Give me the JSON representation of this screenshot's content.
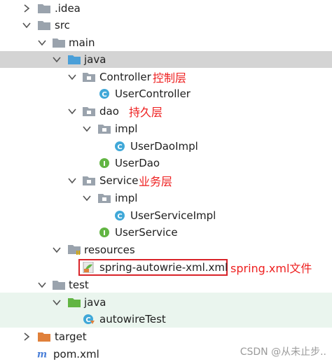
{
  "tree": {
    "idea": "idea",
    "idea_label": ".idea",
    "src": "src",
    "main": "main",
    "java": "java",
    "controller": "Controller",
    "controller_note": "控制层",
    "user_controller": "UserController",
    "dao": "dao",
    "dao_note": "持久层",
    "dao_impl": "impl",
    "user_dao_impl": "UserDaoImpl",
    "user_dao": "UserDao",
    "service": "Service",
    "service_note": "业务层",
    "service_impl": "impl",
    "user_service_impl": "UserServiceImpl",
    "user_service": "UserService",
    "resources": "resources",
    "spring_xml": "spring-autowrie-xml.xml",
    "spring_xml_note": "spring.xml文件",
    "test": "test",
    "test_java": "java",
    "autowire_test": "autowireTest",
    "target": "target",
    "pom": "pom.xml"
  },
  "watermark": "CSDN @从未止步..",
  "colors": {
    "folder": "#9aa3ad",
    "source_folder": "#4a9fd8",
    "test_folder": "#62b543",
    "target_folder": "#e0803a",
    "class_icon": "#40a8d8",
    "interface_icon": "#62b543",
    "annotation": "#ee1f1f",
    "selection": "#d4d4d4"
  }
}
